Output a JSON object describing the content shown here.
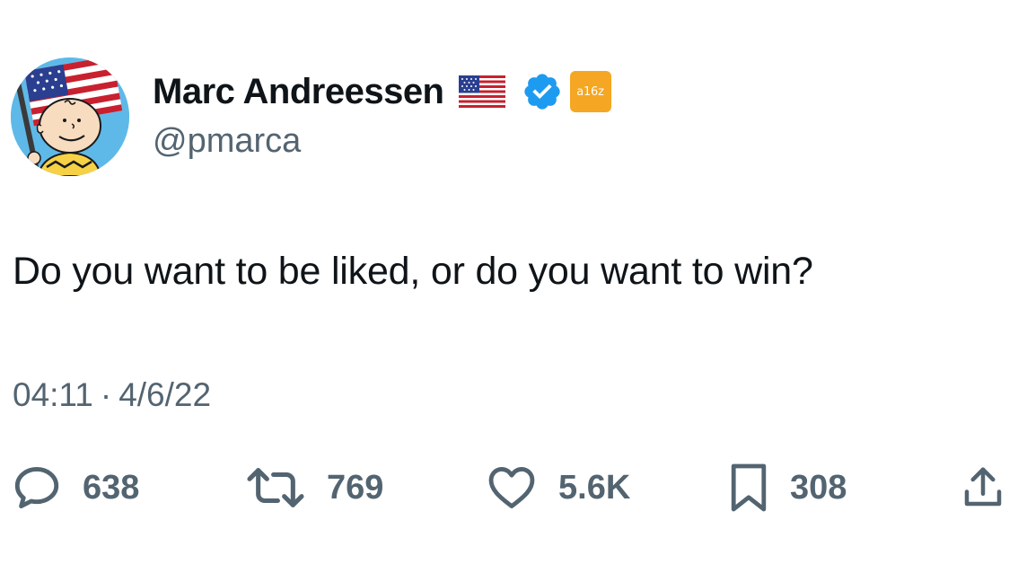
{
  "author": {
    "display_name": "Marc Andreessen",
    "handle": "@pmarca",
    "avatar": "charlie-brown-with-us-flag",
    "name_emoji": "us-flag-emoji",
    "verified_icon": "verified-badge-icon",
    "affiliate_badge_text": "a16z",
    "colors": {
      "verified": "#1d9bf0",
      "affiliate": "#f5a623"
    }
  },
  "tweet": {
    "text": "Do you want to be liked, or do you want to win?",
    "time": "04:11",
    "separator": "·",
    "date": "4/6/22"
  },
  "actions": {
    "reply_count": "638",
    "retweet_count": "769",
    "like_count": "5.6K",
    "bookmark_count": "308",
    "icons": [
      "reply-icon",
      "retweet-icon",
      "heart-icon",
      "bookmark-icon",
      "share-icon"
    ],
    "color": "#536471"
  }
}
